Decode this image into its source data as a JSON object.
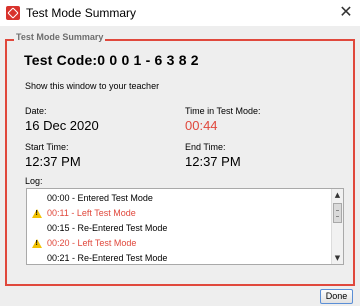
{
  "window": {
    "title": "Test Mode Summary",
    "close_glyph": "✕"
  },
  "panel": {
    "legend": "Test Mode Summary"
  },
  "summary": {
    "test_code": "Test Code:0 0 0 1 - 6 3 8 2",
    "instruction": "Show this window to your teacher",
    "date_label": "Date:",
    "date_value": "16 Dec 2020",
    "time_in_mode_label": "Time in Test Mode:",
    "time_in_mode_value": "00:44",
    "start_label": "Start Time:",
    "start_value": "12:37 PM",
    "end_label": "End Time:",
    "end_value": "12:37 PM",
    "log_label": "Log:"
  },
  "log": {
    "entries": [
      {
        "text": "00:00 - Entered Test Mode",
        "warning": false
      },
      {
        "text": "00:11 - Left Test Mode",
        "warning": true
      },
      {
        "text": "00:15 - Re-Entered Test Mode",
        "warning": false
      },
      {
        "text": "00:20 - Left Test Mode",
        "warning": true
      },
      {
        "text": "00:21 - Re-Entered Test Mode",
        "warning": false
      }
    ]
  },
  "buttons": {
    "done_label": "Done"
  },
  "colors": {
    "accent_red": "#e0483c",
    "warning_yellow": "#f2c200",
    "button_border": "#5b8fd6"
  },
  "icons": {
    "app": "app-logo-icon",
    "close": "close-icon",
    "warning": "warning-icon",
    "scroll_up": "scroll-up-arrow-icon",
    "scroll_down": "scroll-down-arrow-icon"
  }
}
